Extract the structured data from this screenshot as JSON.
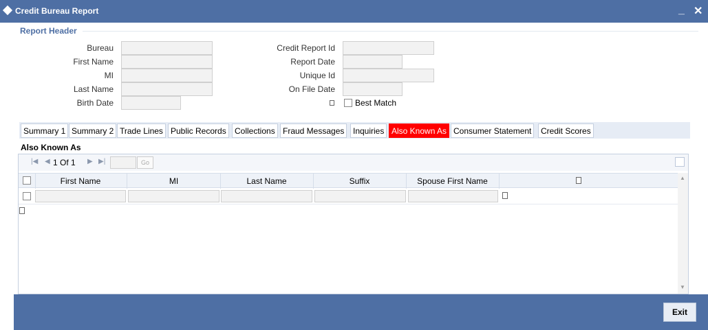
{
  "window": {
    "title": "Credit Bureau Report",
    "minimize_glyph": "_",
    "close_glyph": "✕"
  },
  "report_header": {
    "label": "Report Header",
    "fields": {
      "bureau": {
        "label": "Bureau",
        "value": ""
      },
      "first_name": {
        "label": "First Name",
        "value": ""
      },
      "mi": {
        "label": "MI",
        "value": ""
      },
      "last_name": {
        "label": "Last Name",
        "value": ""
      },
      "birth_date": {
        "label": "Birth Date",
        "value": ""
      },
      "credit_report_id": {
        "label": "Credit Report Id",
        "value": ""
      },
      "report_date": {
        "label": "Report Date",
        "value": ""
      },
      "unique_id": {
        "label": "Unique Id",
        "value": ""
      },
      "on_file_date": {
        "label": "On File Date",
        "value": ""
      },
      "best_match": {
        "label": "Best Match",
        "checked": false
      }
    }
  },
  "tabs": [
    {
      "label": "Summary 1",
      "active": false
    },
    {
      "label": "Summary 2",
      "active": false
    },
    {
      "label": "Trade Lines",
      "active": false
    },
    {
      "label": "Public Records",
      "active": false
    },
    {
      "label": "Collections",
      "active": false
    },
    {
      "label": "Fraud Messages",
      "active": false
    },
    {
      "label": "Inquiries",
      "active": false
    },
    {
      "label": "Also Known As",
      "active": true
    },
    {
      "label": "Consumer Statement",
      "active": false
    },
    {
      "label": "Credit Scores",
      "active": false
    }
  ],
  "also_known_as": {
    "title": "Also Known As",
    "pager": {
      "text": "1 Of 1",
      "go_label": "Go",
      "page_input": ""
    },
    "columns": [
      "First Name",
      "MI",
      "Last Name",
      "Suffix",
      "Spouse First Name"
    ],
    "rows": [
      {
        "first_name": "",
        "mi": "",
        "last_name": "",
        "suffix": "",
        "spouse_first_name": ""
      }
    ]
  },
  "footer": {
    "exit_label": "Exit"
  },
  "colors": {
    "titlebar": "#4e6fa4",
    "active_tab": "#ff0000",
    "header_label": "#4e6fa4"
  },
  "icons": [
    "diamond-icon",
    "minimize-icon",
    "close-icon",
    "first-page-icon",
    "prev-page-icon",
    "next-page-icon",
    "last-page-icon",
    "grid-settings-icon"
  ]
}
